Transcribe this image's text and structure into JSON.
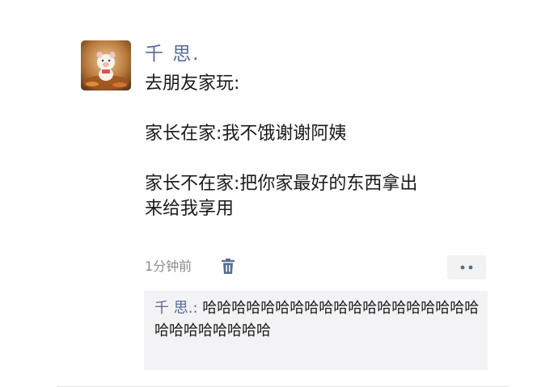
{
  "post": {
    "author": "千 思.",
    "lines": [
      "去朋友家玩:",
      "家长在家:我不饿谢谢阿姨",
      "家长不在家:把你家最好的东西拿出\n来给我享用"
    ],
    "time": "1分钟前",
    "more_label": "••"
  },
  "comment": {
    "author": "千 思.",
    "separator": ": ",
    "text": "哈哈哈哈哈哈哈哈哈哈哈哈哈哈哈哈哈哈哈哈哈哈哈哈哈哈哈"
  },
  "icons": {
    "avatar": "cartoon-pig-avatar",
    "trash": "trash-icon",
    "more": "more-dots-icon"
  },
  "colors": {
    "author": "#576b95",
    "comment_bg": "#f3f3f5",
    "more_bg": "#f2f2f2"
  }
}
